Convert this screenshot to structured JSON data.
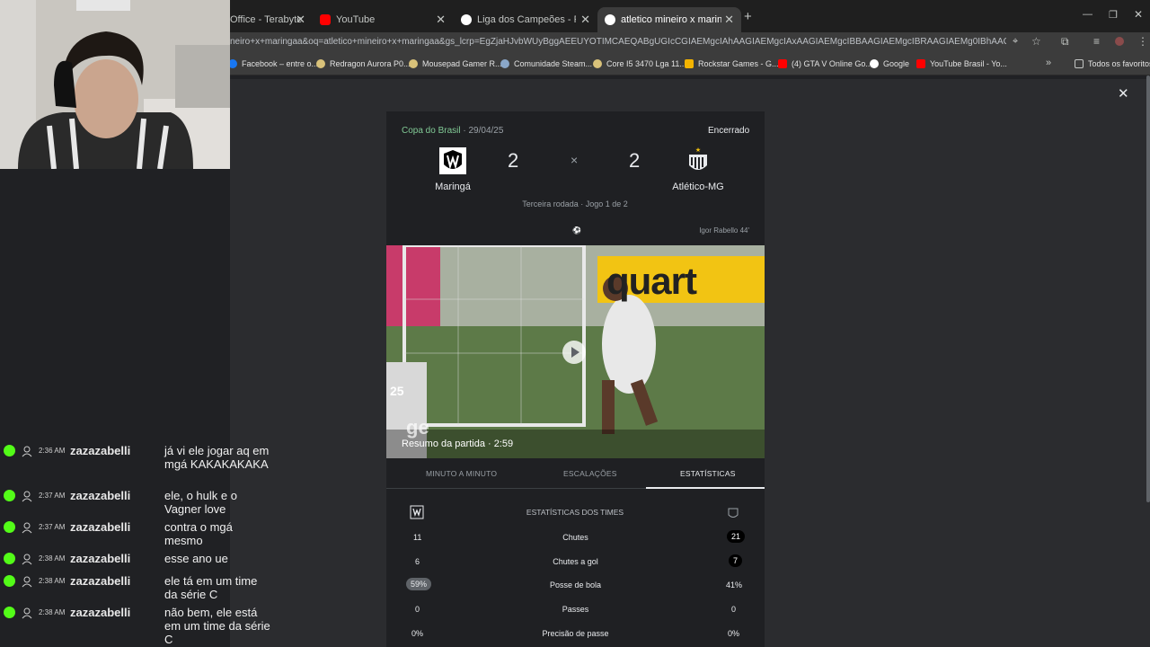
{
  "tabs": [
    {
      "label": "Office - Terabyte",
      "color": "#e8eaed"
    },
    {
      "label": "YouTube",
      "color": "#ff0000"
    },
    {
      "label": "Liga dos Campeões - Pesquisa",
      "color": "#ffffff"
    },
    {
      "label": "atletico mineiro x maringaa - P",
      "color": "#ffffff"
    }
  ],
  "address": {
    "url": "neiro+x+maringaa&oq=atletico+mineiro+x+maringaa&gs_lcrp=EgZjaHJvbWUyBggAEEUYOTIMCAEQABgUGIcCGIAEMgcIAhAAGIAEMgcIAxAAGIAEMgcIBBAAGIAEMgcIBRAAGIAEMg0IBhAAGIMBGLEDGIAEMgc..."
  },
  "bookmarks": [
    {
      "label": "Facebook – entre o...",
      "color": "#1877f2"
    },
    {
      "label": "Redragon Aurora P0...",
      "color": "#d9c27a"
    },
    {
      "label": "Mousepad Gamer R...",
      "color": "#d9c27a"
    },
    {
      "label": "Comunidade Steam...",
      "color": "#8aa7c9"
    },
    {
      "label": "Core I5 3470 Lga 11...",
      "color": "#d9c27a"
    },
    {
      "label": "Rockstar Games - G...",
      "color": "#f4b400"
    },
    {
      "label": "(4) GTA V Online Go...",
      "color": "#ff0000"
    },
    {
      "label": "Google",
      "color": "#ffffff"
    },
    {
      "label": "YouTube Brasil - Yo...",
      "color": "#ff0000"
    }
  ],
  "bookmarks_folder": "Todos os favoritos",
  "match": {
    "competition": "Copa do Brasil",
    "date": "· 29/04/25",
    "status": "Encerrado",
    "home_team": "Maringá",
    "away_team": "Atlético-MG",
    "home_score": "2",
    "away_score": "2",
    "separator": "×",
    "round": "Terceira rodada · Jogo 1 de 2",
    "scorer": "Igor Rabello 44'",
    "video_caption": "Resumo da partida · 2:59",
    "video_ad_text": "quart",
    "video_logo": "ge",
    "player_number": "25"
  },
  "match_tabs": [
    "MINUTO A MINUTO",
    "ESCALAÇÕES",
    "ESTATÍSTICAS"
  ],
  "stats_header": "ESTATÍSTICAS DOS TIMES",
  "stats": [
    {
      "home": "11",
      "label": "Chutes",
      "away": "21",
      "highlight": "away"
    },
    {
      "home": "6",
      "label": "Chutes a gol",
      "away": "7",
      "highlight": "away"
    },
    {
      "home": "59%",
      "label": "Posse de bola",
      "away": "41%",
      "highlight": "home"
    },
    {
      "home": "0",
      "label": "Passes",
      "away": "0",
      "highlight": "none"
    },
    {
      "home": "0%",
      "label": "Precisão de passe",
      "away": "0%",
      "highlight": "none"
    }
  ],
  "chat": [
    {
      "time": "2:36 AM",
      "user": "zazazabelli",
      "message": "já vi ele jogar aq em mgá KAKAKAKAKA"
    },
    {
      "time": "2:37 AM",
      "user": "zazazabelli",
      "message": "ele, o hulk e o Vagner love"
    },
    {
      "time": "2:37 AM",
      "user": "zazazabelli",
      "message": "contra o mgá mesmo"
    },
    {
      "time": "2:38 AM",
      "user": "zazazabelli",
      "message": "esse ano ue"
    },
    {
      "time": "2:38 AM",
      "user": "zazazabelli",
      "message": "ele tá em um time da série C"
    },
    {
      "time": "2:38 AM",
      "user": "zazazabelli",
      "message": "não bem, ele está em um time da série C"
    }
  ]
}
